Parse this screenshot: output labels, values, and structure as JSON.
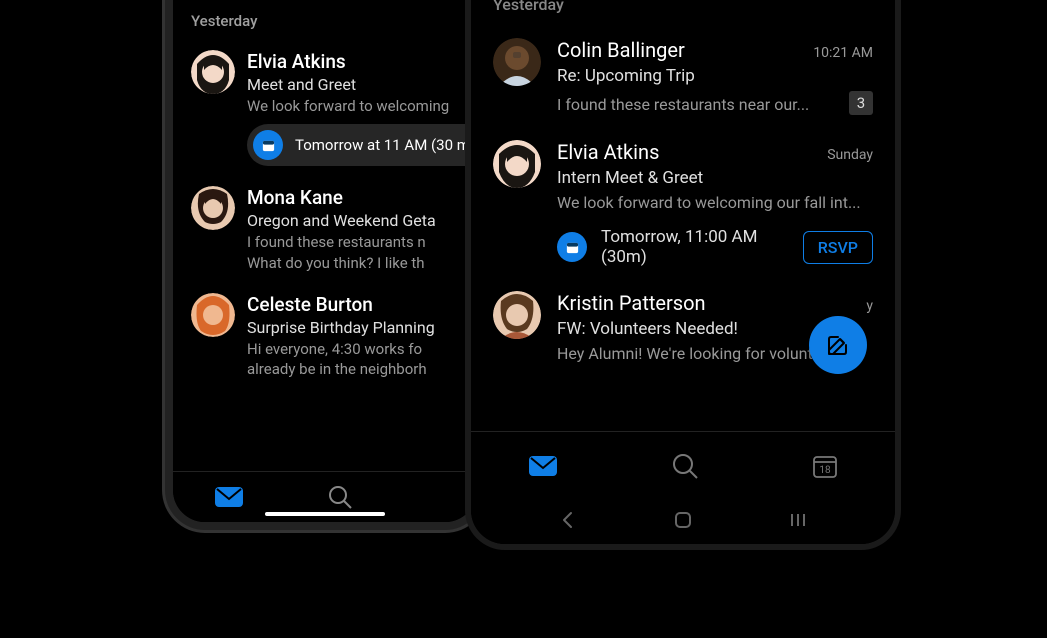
{
  "accent_color": "#0f7ee6",
  "section_label_left": "Yesterday",
  "section_label_right": "Yesterday",
  "emails_left": [
    {
      "sender": "Elvia Atkins",
      "subject": "Meet and Greet",
      "preview": "We look forward to welcoming",
      "event_chip": "Tomorrow at 11 AM (30 m"
    },
    {
      "sender": "Mona Kane",
      "subject": "Oregon and Weekend Geta",
      "preview": "I found these restaurants n What do you think? I like th"
    },
    {
      "sender": "Celeste Burton",
      "subject": "Surprise Birthday Planning",
      "preview": "Hi everyone, 4:30 works fo already be in the neighborh"
    }
  ],
  "emails_right": [
    {
      "sender": "Colin Ballinger",
      "timestamp": "10:21 AM",
      "subject": "Re: Upcoming Trip",
      "preview": "I found these restaurants near our...",
      "badge": "3"
    },
    {
      "sender": "Elvia Atkins",
      "timestamp": "Sunday",
      "subject": "Intern Meet & Greet",
      "preview": "We look forward to welcoming our fall int...",
      "event_text": "Tomorrow, 11:00 AM (30m)",
      "rsvp_label": "RSVP"
    },
    {
      "sender": "Kristin Patterson",
      "timestamp": "y",
      "subject": "FW: Volunteers Needed!",
      "preview": "Hey Alumni! We're looking for voluntee"
    }
  ],
  "calendar_day": "18"
}
